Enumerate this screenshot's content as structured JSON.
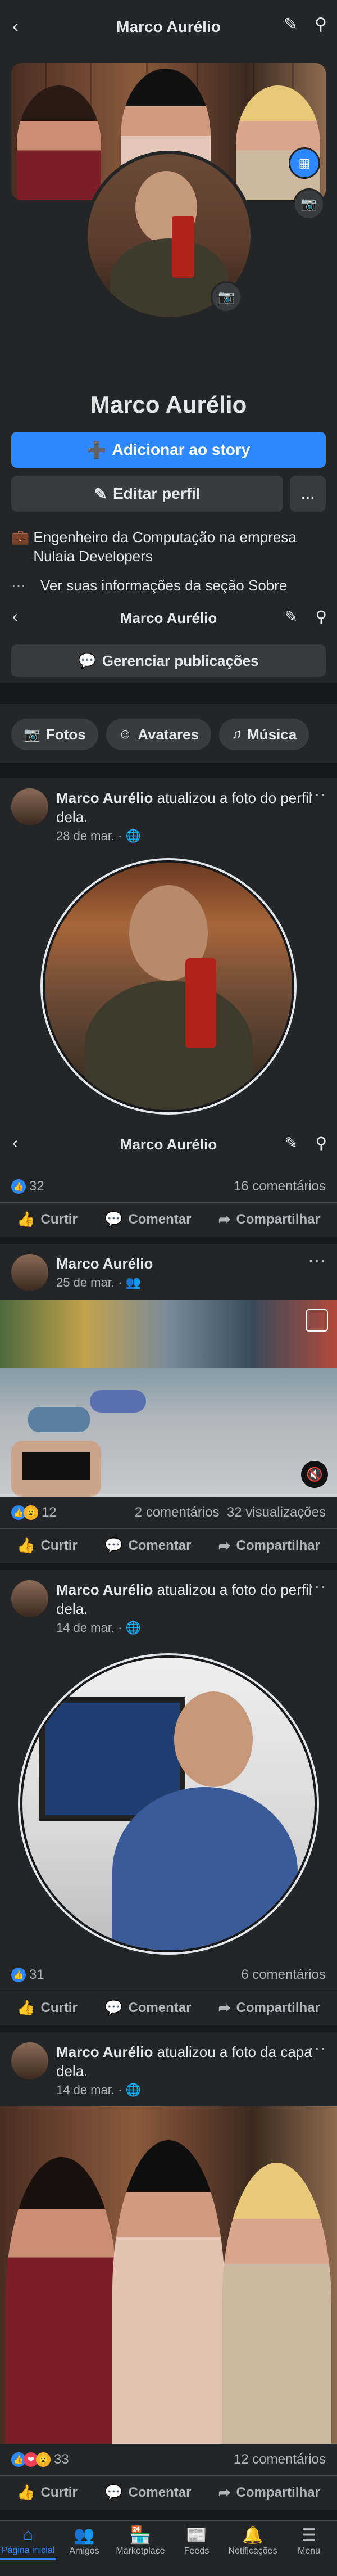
{
  "header": {
    "title": "Marco Aurélio"
  },
  "profile": {
    "name": "Marco Aurélio",
    "add_story": "Adicionar ao story",
    "edit_profile": "Editar perfil",
    "more": "...",
    "work": "Engenheiro da Computação na empresa Nulaia Developers",
    "about": "Ver suas informações da seção Sobre"
  },
  "subheader": {
    "title": "Marco Aurélio",
    "manage": "Gerenciar publicações"
  },
  "chips": [
    {
      "label": "Fotos",
      "icon": "image-icon"
    },
    {
      "label": "Avatares",
      "icon": "avatar-icon"
    },
    {
      "label": "Música",
      "icon": "music-icon"
    }
  ],
  "posts": [
    {
      "author": "Marco Aurélio",
      "action": " atualizou a foto do perfil dela.",
      "date": "28 de mar.",
      "privacy": "globe-icon",
      "overlay_title": "Marco Aurélio",
      "reactions_count": "32",
      "comments": "16 comentários",
      "views": ""
    },
    {
      "author": "Marco Aurélio",
      "action": "",
      "date": "25 de mar.",
      "privacy": "friends-icon",
      "reactions_count": "12",
      "comments": "2 comentários",
      "views": "32 visualizações"
    },
    {
      "author": "Marco Aurélio",
      "action": " atualizou a foto do perfil dela.",
      "date": "14 de mar.",
      "privacy": "globe-icon",
      "reactions_count": "31",
      "comments": "6 comentários",
      "views": ""
    },
    {
      "author": "Marco Aurélio",
      "action": " atualizou a foto da capa dela.",
      "date": "14 de mar.",
      "privacy": "globe-icon",
      "reactions_count": "33",
      "comments": "12 comentários",
      "views": ""
    }
  ],
  "actions": {
    "like": "Curtir",
    "comment": "Comentar",
    "share": "Compartilhar"
  },
  "nav": [
    {
      "label": "Página inicial",
      "icon": "home-icon",
      "active": true
    },
    {
      "label": "Amigos",
      "icon": "friends-icon"
    },
    {
      "label": "Marketplace",
      "icon": "store-icon"
    },
    {
      "label": "Feeds",
      "icon": "feeds-icon"
    },
    {
      "label": "Notificações",
      "icon": "bell-icon"
    },
    {
      "label": "Menu",
      "icon": "menu-icon"
    }
  ],
  "colors": {
    "background": "#18191a",
    "surface": "#242526",
    "accent": "#2d88ff"
  }
}
